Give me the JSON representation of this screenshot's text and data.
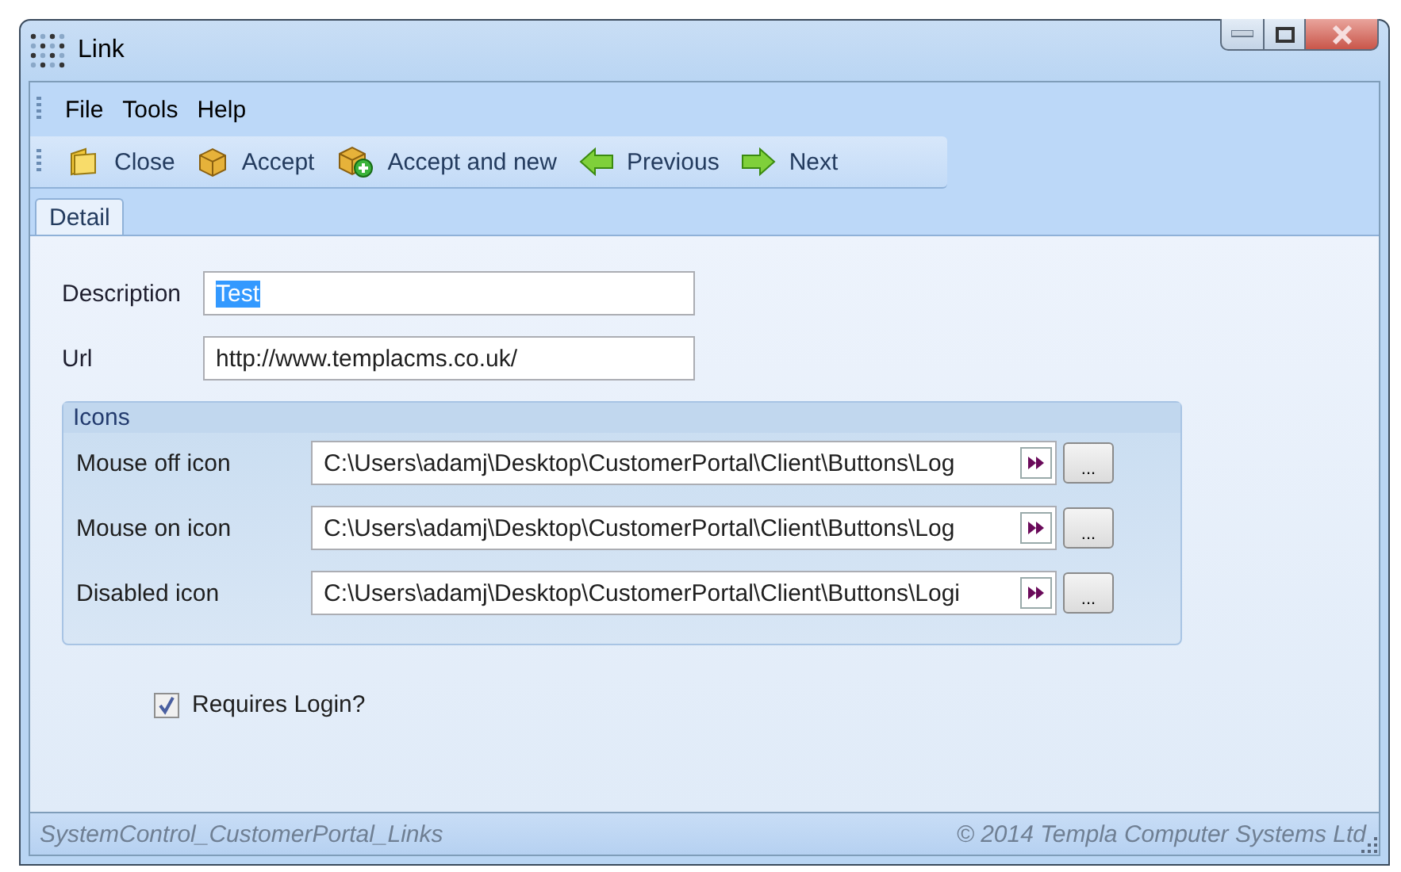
{
  "window": {
    "title": "Link"
  },
  "menu": [
    "File",
    "Tools",
    "Help"
  ],
  "toolbar": [
    {
      "label": "Close",
      "kind": "folder"
    },
    {
      "label": "Accept",
      "kind": "box"
    },
    {
      "label": "Accept and new",
      "kind": "box-add"
    },
    {
      "label": "Previous",
      "kind": "back"
    },
    {
      "label": "Next",
      "kind": "forward"
    }
  ],
  "tabs": [
    {
      "label": "Detail",
      "selected": true
    }
  ],
  "fields": [
    {
      "label": "Description",
      "value": "Test",
      "text_selected": true
    },
    {
      "label": "Url",
      "value": "http://www.templacms.co.uk/",
      "text_selected": false
    }
  ],
  "icons_group": {
    "title": "Icons",
    "rows": [
      {
        "label": "Mouse off icon",
        "value": "C:\\Users\\adamj\\Desktop\\CustomerPortal\\Client\\Buttons\\Log",
        "browse": "..."
      },
      {
        "label": "Mouse on icon",
        "value": "C:\\Users\\adamj\\Desktop\\CustomerPortal\\Client\\Buttons\\Log",
        "browse": "..."
      },
      {
        "label": "Disabled icon",
        "value": "C:\\Users\\adamj\\Desktop\\CustomerPortal\\Client\\Buttons\\Logi",
        "browse": "..."
      }
    ]
  },
  "requires_login": {
    "label": "Requires Login?",
    "checked": true
  },
  "status_bar": {
    "left": "SystemControl_CustomerPortal_Links",
    "right": "© 2014 Templa Computer Systems Ltd"
  }
}
